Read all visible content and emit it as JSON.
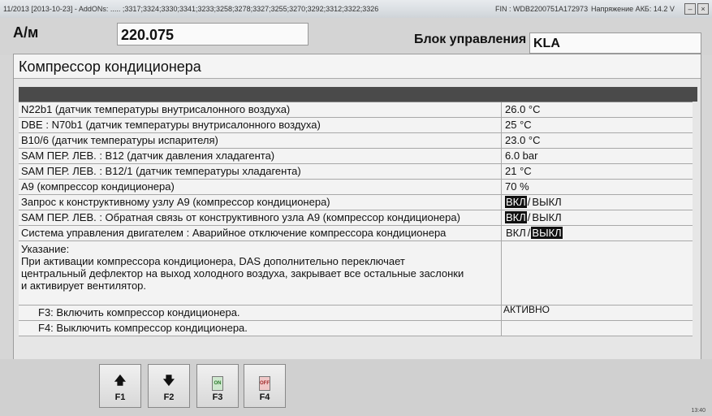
{
  "titlebar": {
    "left": "11/2013 [2013-10-23] - AddONs: ..... ;3317;3324;3330;3341;3233;3258;3278;3327;3255;3270;3292;3312;3322;3326",
    "fin": "FIN : WDB2200751A172973",
    "akb": "Напряжение АКБ: 14.2 V"
  },
  "header": {
    "am_label": "А/м",
    "am_value": "220.075",
    "block_label": "Блок управления",
    "block_value": "KLA"
  },
  "page": {
    "title": "Компрессор кондиционера"
  },
  "rows": [
    {
      "label": "N22b1 (датчик температуры внутрисалонного воздуха)",
      "value": "26.0 °C"
    },
    {
      "label": "DBE : N70b1 (датчик температуры внутрисалонного воздуха)",
      "value": " 25 °C"
    },
    {
      "label": "B10/6 (датчик температуры испарителя)",
      "value": "23.0 °C"
    },
    {
      "label": "SAM ПЕР. ЛЕВ. : B12 (датчик давления хладагента)",
      "value": "6.0 bar"
    },
    {
      "label": "SAM ПЕР. ЛЕВ. : B12/1 (датчик температуры хладагента)",
      "value": " 21 °C"
    },
    {
      "label": "A9 (компрессор кондиционера)",
      "value": "70 %"
    }
  ],
  "toggle_rows": [
    {
      "label": "Запрос к конструктивному узлу A9 (компрессор кондиционера)",
      "on": "ВКЛ",
      "sep": "/",
      "off": "ВЫКЛ",
      "active": "on"
    },
    {
      "label": "SAM ПЕР. ЛЕВ. : Обратная связь от конструктивного узла A9 (компрессор кондиционера)",
      "on": "ВКЛ",
      "sep": "/",
      "off": "ВЫКЛ",
      "active": "on"
    },
    {
      "label": "Система управления двигателем : Аварийное отключение компрессора кондиционера",
      "on": "ВКЛ",
      "sep": "/",
      "off": "ВЫКЛ",
      "active": "off"
    }
  ],
  "note": {
    "lines": [
      "Указание:",
      "При активации компрессора кондиционера, DAS дополнительно переключает",
      "центральный дефлектор на выход холодного воздуха, закрывает все остальные заслонки",
      "и активирует вентилятор."
    ]
  },
  "functions": [
    {
      "label": "F3: Включить компрессор кондиционера.",
      "status": "АКТИВНО"
    },
    {
      "label": "F4: Выключить компрессор кондиционера.",
      "status": ""
    }
  ],
  "fkeys": [
    {
      "name": "F1",
      "icon": "arrow-up-icon",
      "glyph": "🡅"
    },
    {
      "name": "F2",
      "icon": "arrow-down-icon",
      "glyph": "🡇"
    },
    {
      "name": "F3",
      "icon": "lamp-on-icon",
      "lamp": "ON"
    },
    {
      "name": "F4",
      "icon": "lamp-off-icon",
      "lamp": "OFF"
    }
  ],
  "taskbar": {
    "time": "13:40"
  }
}
